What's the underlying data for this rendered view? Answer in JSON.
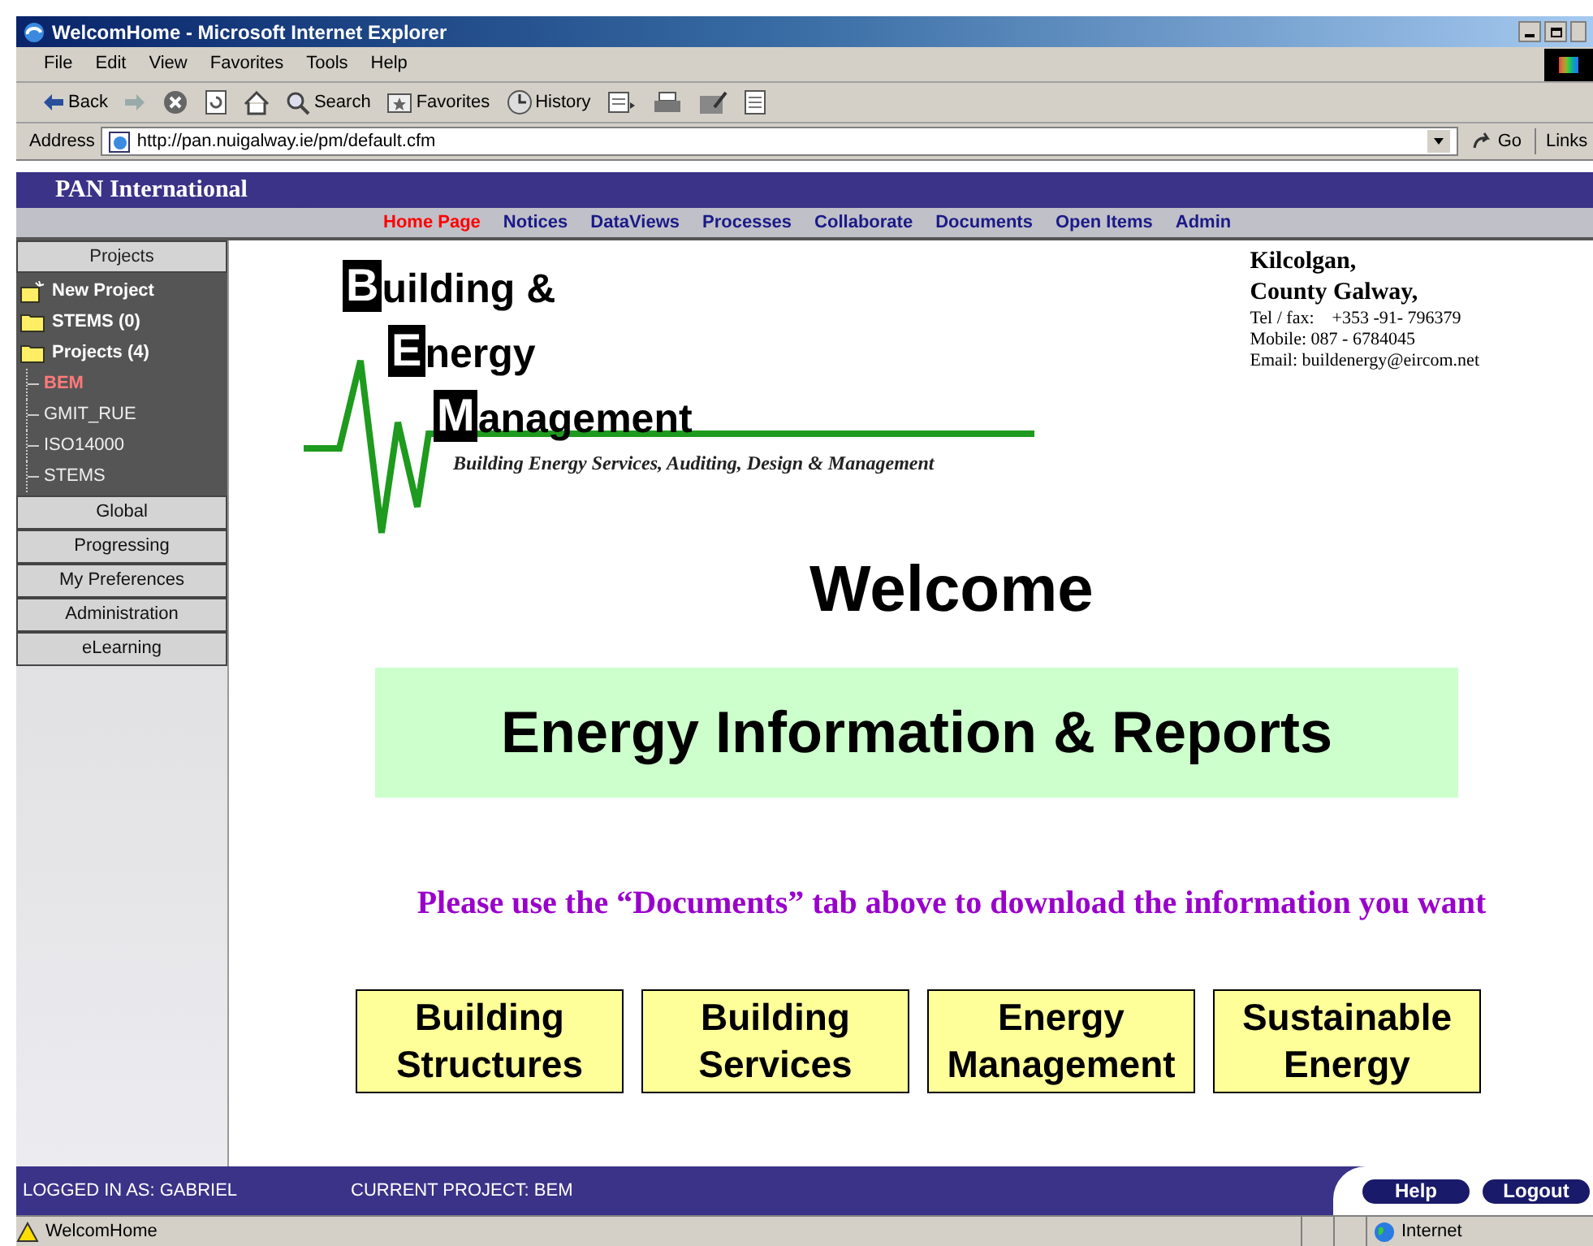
{
  "window": {
    "title": "WelcomHome - Microsoft Internet Explorer"
  },
  "menu": [
    "File",
    "Edit",
    "View",
    "Favorites",
    "Tools",
    "Help"
  ],
  "toolbar": [
    {
      "kind": "back",
      "label": "Back"
    },
    {
      "kind": "forward"
    },
    {
      "kind": "stop"
    },
    {
      "kind": "refresh"
    },
    {
      "kind": "home"
    },
    {
      "kind": "search",
      "label": "Search"
    },
    {
      "kind": "favorites",
      "label": "Favorites"
    },
    {
      "kind": "history",
      "label": "History"
    },
    {
      "kind": "mail"
    },
    {
      "kind": "print"
    },
    {
      "kind": "edit"
    },
    {
      "kind": "discuss"
    }
  ],
  "address": {
    "label": "Address",
    "value": "http://pan.nuigalway.ie/pm/default.cfm",
    "go": "Go",
    "links": "Links"
  },
  "app": {
    "brand": "PAN International",
    "nav": [
      {
        "label": "Home Page",
        "selected": true
      },
      {
        "label": "Notices",
        "selected": false
      },
      {
        "label": "DataViews",
        "selected": false
      },
      {
        "label": "Processes",
        "selected": false
      },
      {
        "label": "Collaborate",
        "selected": false
      },
      {
        "label": "Documents",
        "selected": false
      },
      {
        "label": "Open Items",
        "selected": false
      },
      {
        "label": "Admin",
        "selected": false
      }
    ],
    "sidebar": {
      "header": "Projects",
      "tree": [
        {
          "kind": "new",
          "label": "New Project"
        },
        {
          "kind": "folder",
          "label": "STEMS (0)"
        },
        {
          "kind": "folder",
          "label": "Projects (4)",
          "children": [
            {
              "label": "BEM",
              "selected": true
            },
            {
              "label": "GMIT_RUE",
              "selected": false
            },
            {
              "label": "ISO14000",
              "selected": false
            },
            {
              "label": "STEMS",
              "selected": false
            }
          ]
        }
      ],
      "sections": [
        "Global",
        "Progressing",
        "My Preferences",
        "Administration",
        "eLearning"
      ]
    },
    "content": {
      "logo": [
        {
          "initial": "B",
          "rest": "uilding &"
        },
        {
          "initial": "E",
          "rest": "nergy"
        },
        {
          "initial": "M",
          "rest": "anagement"
        }
      ],
      "tagline": "Building Energy Services, Auditing, Design & Management",
      "contact": {
        "lines": [
          "Kilcolgan,",
          "County Galway,"
        ],
        "details": [
          "Tel / fax:    +353 -91- 796379",
          "Mobile: 087 - 6784045",
          "Email: buildenergy@eircom.net"
        ]
      },
      "welcome": "Welcome",
      "banner": "Energy Information & Reports",
      "instruction": "Please use the “Documents” tab above to download the information you want",
      "tiles": [
        {
          "lines": [
            "Building",
            "Structures"
          ]
        },
        {
          "lines": [
            "Building",
            "Services"
          ]
        },
        {
          "lines": [
            "Energy",
            "Management"
          ]
        },
        {
          "lines": [
            "Sustainable",
            "Energy"
          ]
        }
      ]
    },
    "footer": {
      "logged_in": "LOGGED IN AS: GABRIEL",
      "project": "CURRENT PROJECT: BEM",
      "buttons": [
        "Help",
        "Logout"
      ]
    }
  },
  "status": {
    "text": "WelcomHome",
    "zone": "Internet"
  }
}
